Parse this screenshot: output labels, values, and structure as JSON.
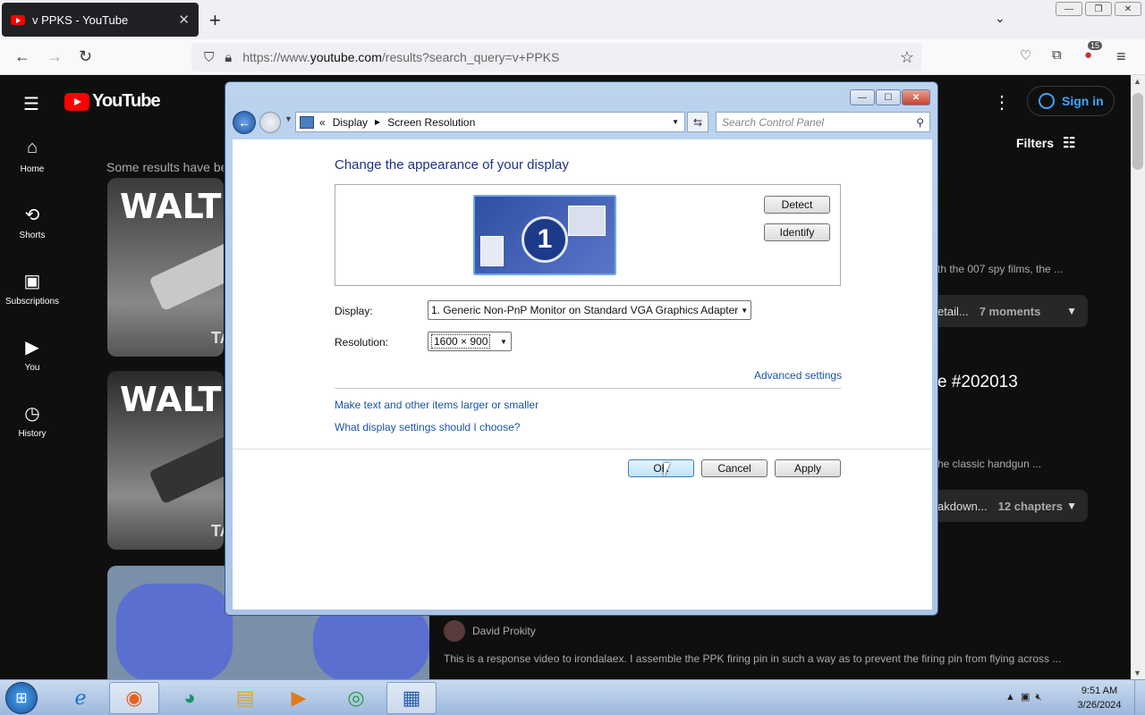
{
  "browser": {
    "tab_title": "v PPKS - YouTube",
    "tab_close": "✕",
    "new_tab": "+",
    "url_prefix": "https://www.",
    "url_domain": "youtube.com",
    "url_path": "/results?search_query=v+PPKS",
    "extension_badge": "15"
  },
  "youtube": {
    "logo_text": "YouTube",
    "sign_in": "Sign in",
    "filters": "Filters",
    "results_note": "Some results have be",
    "sidebar": [
      {
        "label": "Home",
        "icon": "home-icon",
        "glyph": "⌂"
      },
      {
        "label": "Shorts",
        "icon": "shorts-icon",
        "glyph": "⟲"
      },
      {
        "label": "Subscriptions",
        "icon": "subscriptions-icon",
        "glyph": "▣"
      },
      {
        "label": "You",
        "icon": "you-icon",
        "glyph": "▶"
      },
      {
        "label": "History",
        "icon": "history-icon",
        "glyph": "◷"
      }
    ],
    "thumb_title": "WALTHE",
    "thumb_tag": "TA",
    "result1_desc": "th the 007 spy films, the ...",
    "result1_chapters_prefix": "etail...",
    "result1_chapters": "7 moments",
    "result2_title": "e #202013",
    "result2_desc": "he classic handgun ...",
    "result2_chapters_prefix": "akdown...",
    "result2_chapters": "12 chapters",
    "result3_channel": "David Prokity",
    "result3_desc": "This is a response video to irondalaex. I assemble the PPK firing pin in such a way as to prevent the firing pin from flying across ..."
  },
  "dialog": {
    "breadcrumb_root": "«",
    "breadcrumb_1": "Display",
    "breadcrumb_2": "Screen Resolution",
    "search_placeholder": "Search Control Panel",
    "heading": "Change the appearance of your display",
    "monitor_number": "1",
    "detect": "Detect",
    "identify": "Identify",
    "display_label": "Display:",
    "display_value": "1. Generic Non-PnP Monitor on Standard VGA Graphics Adapter",
    "resolution_label": "Resolution:",
    "resolution_value": "1600 × 900",
    "advanced_settings": "Advanced settings",
    "link_text_size": "Make text and other items larger or smaller",
    "link_help": "What display settings should I choose?",
    "ok": "OK",
    "cancel": "Cancel",
    "apply": "Apply"
  },
  "taskbar": {
    "time": "9:51 AM",
    "date": "3/26/2024"
  }
}
